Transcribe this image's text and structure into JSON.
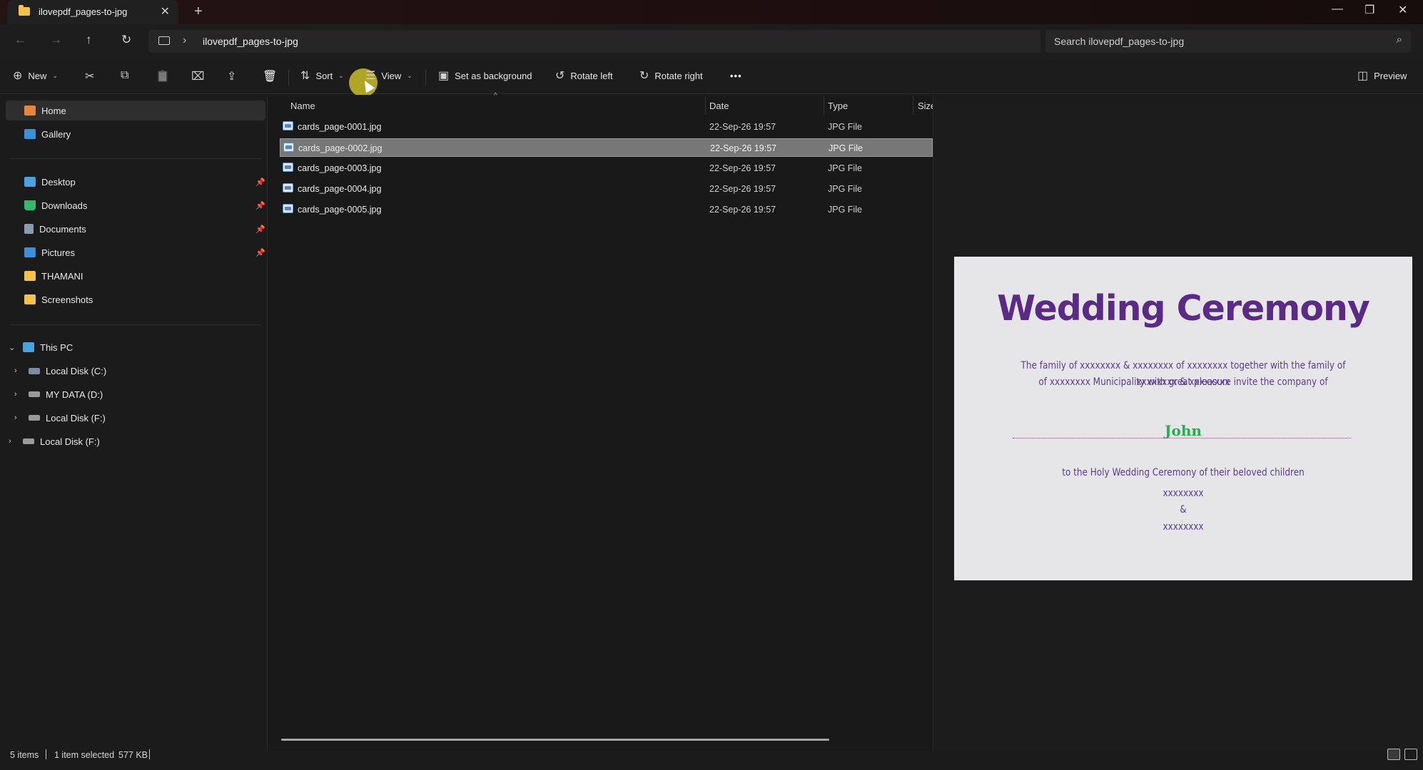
{
  "window": {
    "tab_title": "ilovepdf_pages-to-jpg",
    "new_tab": "+",
    "tab_close": "✕",
    "minimize": "—",
    "maximize": "❐",
    "close": "✕"
  },
  "nav": {
    "back": "←",
    "forward": "→",
    "up": "↑",
    "refresh": "↻",
    "chevron": "›",
    "path": "ilovepdf_pages-to-jpg",
    "search_placeholder": "Search ilovepdf_pages-to-jpg",
    "search_icon": "⌕"
  },
  "toolbar": {
    "new_label": "New",
    "sort_label": "Sort",
    "view_label": "View",
    "set_background_label": "Set as background",
    "rotate_left_label": "Rotate left",
    "rotate_right_label": "Rotate right",
    "more_label": "•••",
    "preview_label": "Preview",
    "icons": {
      "new": "⊕",
      "cut": "✂",
      "copy": "⧉",
      "paste": "📋",
      "rename": "⌧",
      "share": "⇪",
      "delete": "🗑",
      "sort": "⇅",
      "view": "☰",
      "background": "▣",
      "rotate_left": "↺",
      "rotate_right": "↻",
      "preview": "◫",
      "dropdown": "⌄"
    }
  },
  "sidebar": {
    "quick": [
      {
        "label": "Home",
        "color": "#e8843b"
      },
      {
        "label": "Gallery",
        "color": "#3d8fd8"
      }
    ],
    "pinned": [
      {
        "label": "Desktop",
        "color": "#4aa3df"
      },
      {
        "label": "Downloads",
        "color": "#35b86a"
      },
      {
        "label": "Documents",
        "color": "#8c9bb0"
      },
      {
        "label": "Pictures",
        "color": "#3f8ed8"
      },
      {
        "label": "THAMANI",
        "color": "#f4c04e"
      },
      {
        "label": "Screenshots",
        "color": "#f4c04e"
      }
    ],
    "pin_icon": "📌",
    "this_pc": "This PC",
    "drives": [
      {
        "label": "Local Disk (C:)"
      },
      {
        "label": "MY DATA (D:)"
      },
      {
        "label": "Local Disk (F:)"
      },
      {
        "label": "Local Disk (F:)"
      }
    ],
    "expand_icon": "›",
    "collapse_icon": "⌄"
  },
  "file_list": {
    "columns": [
      "Name",
      "Date",
      "Type",
      "Size"
    ],
    "sort_indicator": "^",
    "rows": [
      {
        "name": "cards_page-0001.jpg",
        "date": "22-Sep-26 19:57",
        "type": "JPG File",
        "selected": false
      },
      {
        "name": "cards_page-0002.jpg",
        "date": "22-Sep-26 19:57",
        "type": "JPG File",
        "selected": true
      },
      {
        "name": "cards_page-0003.jpg",
        "date": "22-Sep-26 19:57",
        "type": "JPG File",
        "selected": false
      },
      {
        "name": "cards_page-0004.jpg",
        "date": "22-Sep-26 19:57",
        "type": "JPG File",
        "selected": false
      },
      {
        "name": "cards_page-0005.jpg",
        "date": "22-Sep-26 19:57",
        "type": "JPG File",
        "selected": false
      }
    ]
  },
  "preview": {
    "title": "Wedding Ceremony",
    "line1": "The family of xxxxxxxx & xxxxxxxx of  xxxxxxxx together with the family of  xxxxxxxx & xxxxxxxx",
    "line2": "of xxxxxxxx Municipality with great pleasure invite the company of",
    "guest": "John",
    "line3": "to the Holy Wedding Ceremony of their beloved children",
    "name1": "xxxxxxxx",
    "amp": "&",
    "name2": "xxxxxxxx"
  },
  "status": {
    "items": "5 items",
    "selected": "1 item selected",
    "size": "577 KB"
  }
}
